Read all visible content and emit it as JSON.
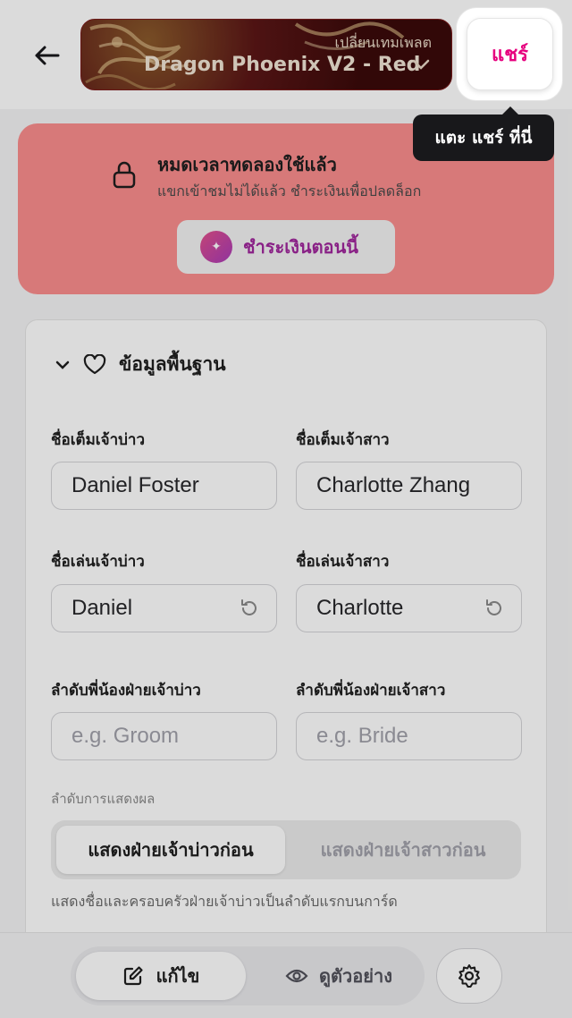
{
  "header": {
    "back_icon": "arrow-left-icon",
    "template": {
      "subtitle": "เปลี่ยนเทมเพลต",
      "name": "Dragon Phoenix V2 - Red",
      "chevron_icon": "chevron-down-icon"
    },
    "share_label": "แชร์",
    "tooltip": "แตะ แชร์ ที่นี่"
  },
  "banner": {
    "icon": "lock-icon",
    "title": "หมดเวลาทดลองใช้แล้ว",
    "description": "แขกเข้าชมไม่ได้แล้ว ชำระเงินเพื่อปลดล็อก",
    "pay_label": "ชำระเงินตอนนี้",
    "pay_icon": "sparkle-icon",
    "color": "#fb8d8d"
  },
  "section": {
    "title": "ข้อมูลพื้นฐาน",
    "chevron_icon": "chevron-down-icon",
    "heart_icon": "heart-icon",
    "groom_fullname_label": "ชื่อเต็มเจ้าบ่าว",
    "groom_fullname": "Daniel Foster",
    "bride_fullname_label": "ชื่อเต็มเจ้าสาว",
    "bride_fullname": "Charlotte Zhang",
    "groom_nick_label": "ชื่อเล่นเจ้าบ่าว",
    "groom_nick": "Daniel",
    "bride_nick_label": "ชื่อเล่นเจ้าสาว",
    "bride_nick": "Charlotte",
    "groom_sibling_label": "ลำดับพี่น้องฝ่ายเจ้าบ่าว",
    "groom_sibling_placeholder": "e.g. Groom",
    "bride_sibling_label": "ลำดับพี่น้องฝ่ายเจ้าสาว",
    "bride_sibling_placeholder": "e.g. Bride",
    "display_order_label": "ลำดับการแสดงผล",
    "order_options": [
      "แสดงฝ่ายเจ้าบ่าวก่อน",
      "แสดงฝ่ายเจ้าสาวก่อน"
    ],
    "order_selected": "แสดงฝ่ายเจ้าบ่าวก่อน",
    "order_hint": "แสดงชื่อและครอบครัวฝ่ายเจ้าบ่าวเป็นลำดับแรกบนการ์ด"
  },
  "bottom_bar": {
    "edit_label": "แก้ไข",
    "edit_icon": "pencil-square-icon",
    "preview_label": "ดูตัวอย่าง",
    "preview_icon": "eye-icon",
    "settings_icon": "gear-icon"
  },
  "colors": {
    "accent": "#e6007e",
    "pay_text": "#a0279c",
    "template_bg": "#3b0a0a"
  }
}
